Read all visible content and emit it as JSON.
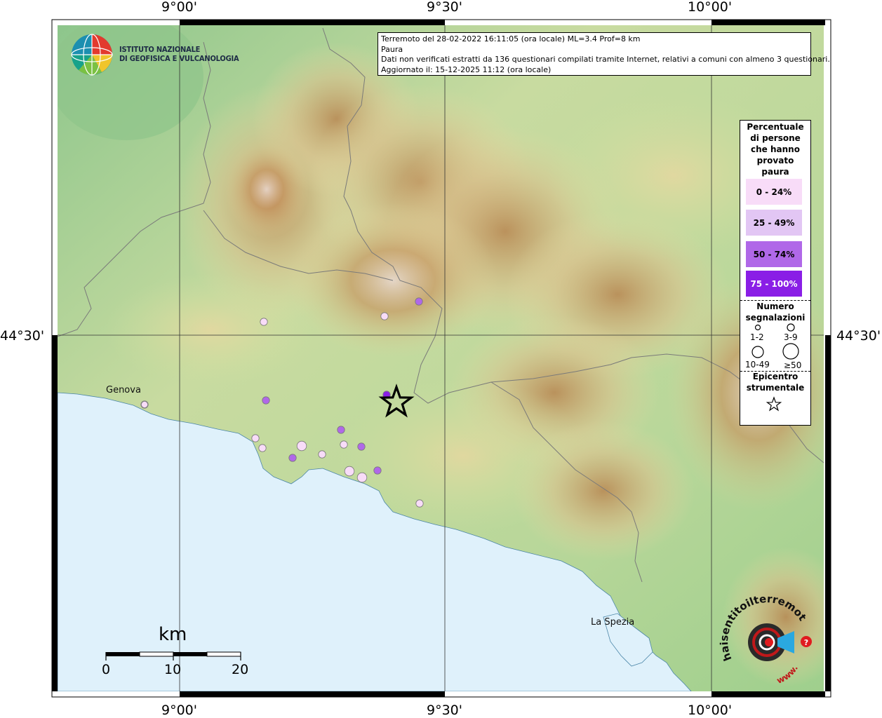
{
  "info": {
    "line1": "Terremoto del 28-02-2022 16:11:05 (ora locale) ML=3.4 Prof=8 km",
    "line2": "Paura",
    "line3": "Dati non verificati estratti da 136 questionari compilati tramite Internet, relativi a comuni con almeno 3 questionari.",
    "line4": "Aggiornato il: 15-12-2025 11:12 (ora locale)"
  },
  "ingv": {
    "line1": "ISTITUTO NAZIONALE",
    "line2": "DI GEOFISICA E VULCANOLOGIA"
  },
  "coords": {
    "lon1": "9°00'",
    "lon2": "9°30'",
    "lon3": "10°00'",
    "lat1": "44°30'"
  },
  "places": {
    "genova": "Genova",
    "la_spezia": "La Spezia"
  },
  "scale": {
    "unit": "km",
    "t0": "0",
    "t1": "10",
    "t2": "20"
  },
  "legend": {
    "title": [
      "Percentuale",
      "di persone",
      "che hanno",
      "provato",
      "paura"
    ],
    "classes": [
      {
        "label": "0 - 24%",
        "color": "#f8dcf8"
      },
      {
        "label": "25 - 49%",
        "color": "#e2c6f4"
      },
      {
        "label": "50 - 74%",
        "color": "#b068e8"
      },
      {
        "label": "75 - 100%",
        "color": "#8a1ee6"
      }
    ],
    "count_title": [
      "Numero",
      "segnalazioni"
    ],
    "counts": [
      "1-2",
      "3-9",
      "10-49",
      "≥50"
    ],
    "epi_title": [
      "Epicentro",
      "strumentale"
    ]
  },
  "logo_text": "haisentitoilterremoto.it",
  "logo_url": "www.",
  "colors": {
    "sea": "#dff1fb",
    "lowland": "#9fcf8d",
    "hills": "#e7dca3",
    "mountains": "#bf9158",
    "peaks": "#e4cdc5"
  },
  "observations": [
    {
      "place": "p1",
      "cls": 0,
      "count": "1-2"
    },
    {
      "place": "p2",
      "cls": 0,
      "count": "1-2"
    },
    {
      "place": "p3",
      "cls": 2,
      "count": "1-2"
    },
    {
      "place": "p4",
      "cls": 3,
      "count": "1-2"
    },
    {
      "place": "p5",
      "cls": 0,
      "count": "1-2"
    },
    {
      "place": "p6",
      "cls": 2,
      "count": "1-2"
    },
    {
      "place": "p7",
      "cls": 0,
      "count": "1-2"
    },
    {
      "place": "p8",
      "cls": 0,
      "count": "1-2"
    },
    {
      "place": "p9",
      "cls": 2,
      "count": "1-2"
    },
    {
      "place": "p10",
      "cls": 0,
      "count": "3-9"
    },
    {
      "place": "p11",
      "cls": 2,
      "count": "1-2"
    },
    {
      "place": "p12",
      "cls": 0,
      "count": "1-2"
    },
    {
      "place": "p13",
      "cls": 0,
      "count": "1-2"
    },
    {
      "place": "p14",
      "cls": 2,
      "count": "1-2"
    },
    {
      "place": "p15",
      "cls": 2,
      "count": "1-2"
    },
    {
      "place": "p16",
      "cls": 0,
      "count": "3-9"
    },
    {
      "place": "p17",
      "cls": 0,
      "count": "3-9"
    },
    {
      "place": "p18",
      "cls": 0,
      "count": "1-2"
    }
  ]
}
